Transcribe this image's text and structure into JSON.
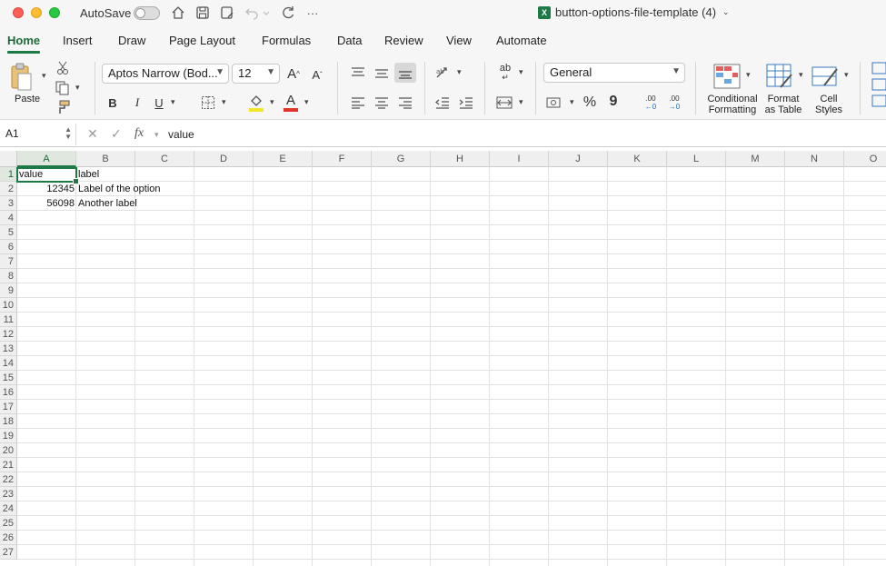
{
  "titlebar": {
    "autosave_label": "AutoSave",
    "doc_title": "button-options-file-template (4)",
    "excel_badge": "X",
    "more_label": "···"
  },
  "tabs": [
    {
      "label": "Home"
    },
    {
      "label": "Insert"
    },
    {
      "label": "Draw"
    },
    {
      "label": "Page Layout"
    },
    {
      "label": "Formulas"
    },
    {
      "label": "Data"
    },
    {
      "label": "Review"
    },
    {
      "label": "View"
    },
    {
      "label": "Automate"
    }
  ],
  "ribbon": {
    "paste_label": "Paste",
    "font_name": "Aptos Narrow (Bod...",
    "font_size": "12",
    "bold": "B",
    "italic": "I",
    "underline": "U",
    "number_format": "General",
    "percent": "%",
    "comma": "9",
    "cond_fmt_line1": "Conditional",
    "cond_fmt_line2": "Formatting",
    "fmt_table_line1": "Format",
    "fmt_table_line2": "as Table",
    "cell_styles_line1": "Cell",
    "cell_styles_line2": "Styles",
    "inc_font": "A",
    "dec_font": "A",
    "font_color_letter": "A",
    "wrap_label": "ab",
    "dec_dec": ".00",
    "inc_dec": ".00"
  },
  "colors": {
    "accent": "#1d7a45",
    "font_color_bar": "#e0332c",
    "fill_bar": "#f5e52a"
  },
  "formula_bar": {
    "name_box": "A1",
    "fx": "fx",
    "content": "value"
  },
  "grid": {
    "columns": [
      "A",
      "B",
      "C",
      "D",
      "E",
      "F",
      "G",
      "H",
      "I",
      "J",
      "K",
      "L",
      "M",
      "N",
      "O"
    ],
    "rows": [
      "1",
      "2",
      "3",
      "4",
      "5",
      "6",
      "7",
      "8",
      "9",
      "10",
      "11",
      "12",
      "13",
      "14",
      "15",
      "16",
      "17",
      "18",
      "19",
      "20",
      "21",
      "22",
      "23",
      "24",
      "25",
      "26",
      "27"
    ],
    "cells": {
      "A1": "value",
      "B1": "label",
      "A2": "12345",
      "B2": "Label of the option",
      "A3": "56098",
      "B3": "Another label"
    }
  }
}
